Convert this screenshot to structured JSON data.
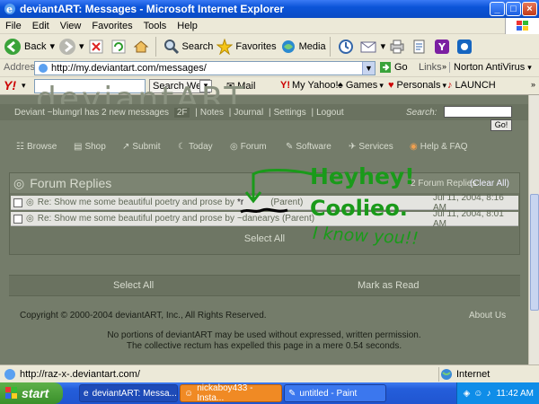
{
  "window": {
    "title": "deviantART: Messages - Microsoft Internet Explorer"
  },
  "menu": [
    "File",
    "Edit",
    "View",
    "Favorites",
    "Tools",
    "Help"
  ],
  "toolbar": {
    "back": "Back",
    "search": "Search",
    "favorites": "Favorites",
    "media": "Media"
  },
  "address": {
    "label": "Address",
    "url": "http://my.deviantart.com/messages/",
    "go": "Go",
    "links": "Links",
    "antivirus": "Norton AntiVirus"
  },
  "yahoo": {
    "search_btn": "Search Web",
    "items": [
      "Mail",
      "My Yahoo!",
      "Games",
      "Personals",
      "LAUNCH"
    ]
  },
  "site": {
    "logo": "deviantART",
    "user_line": "Deviant ~blumgrl has 2 new messages",
    "msg_count": "2F",
    "top_links": [
      "Notes",
      "Journal",
      "Settings",
      "Logout"
    ],
    "search_label": "Search:",
    "go": "Go!",
    "nav": [
      "Browse",
      "Shop",
      "Submit",
      "Today",
      "Forum",
      "Software",
      "Services",
      "Help & FAQ"
    ]
  },
  "forum": {
    "title": "Forum Replies",
    "count_text": "2 Forum Replies",
    "clear_all": "(Clear All)",
    "rows": [
      {
        "subject": "Re: Show me some beautiful poetry and prose",
        "by": "by",
        "user": "*r",
        "parent": "(Parent)",
        "date": "Jul 11, 2004, 8:16 AM"
      },
      {
        "subject": "Re: Show me some beautiful poetry and prose",
        "by": "by",
        "user": "~danearys",
        "parent": "(Parent)",
        "date": "Jul 11, 2004, 8:01 AM"
      }
    ],
    "select_all": "Select All"
  },
  "footer_bar": {
    "select_all": "Select All",
    "mark_read": "Mark as Read"
  },
  "footer": {
    "copyright": "Copyright © 2000-2004 deviantART, Inc., All Rights Reserved.",
    "about": "About Us",
    "line1": "No portions of deviantART may be used without expressed, written permission.",
    "line2": "The collective rectum has expelled this page in a mere 0.54 seconds."
  },
  "handwriting": {
    "line1": "Heyhey!",
    "line2": "Coolieo.",
    "line3": "I know you!!"
  },
  "status": {
    "url": "http://raz-x-.deviantart.com/",
    "zone": "Internet"
  },
  "taskbar": {
    "start": "start",
    "tasks": [
      "deviantART: Messa...",
      "nickaboy433 - Insta...",
      "untitled - Paint"
    ],
    "clock": "11:42 AM"
  },
  "colors": {
    "page_bg": "#747c6a",
    "handwriting": "#1a9a1a",
    "xp_blue": "#245edb"
  }
}
